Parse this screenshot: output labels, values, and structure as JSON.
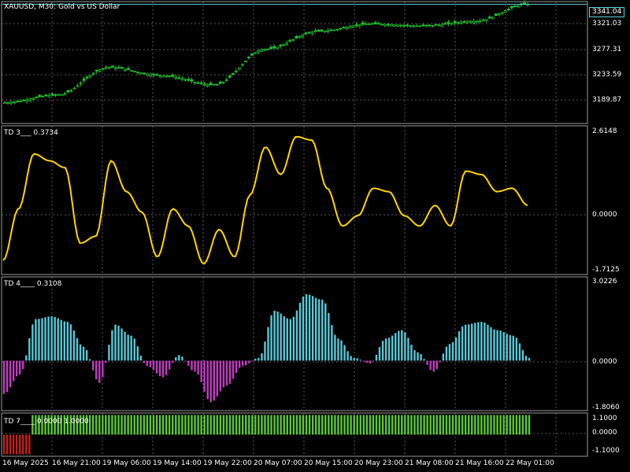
{
  "chart_window": {
    "symbol_title": "XAUUSD, M30:  Gold vs US Dollar",
    "current_price": "3341.04",
    "y_labels": [
      "3321.03",
      "3277.31",
      "3233.59",
      "3189.87"
    ],
    "colors": {
      "background": "#000000",
      "grid": "#6a6a6a",
      "price_candles": "#22c32e",
      "axis": "#ffffff"
    }
  },
  "x_axis": {
    "labels": [
      "16 May 2025",
      "16 May 21:00",
      "19 May 06:00",
      "19 May 14:00",
      "19 May 22:00",
      "20 May 07:00",
      "20 May 15:00",
      "20 May 23:00",
      "21 May 08:00",
      "21 May 16:00",
      "22 May 01:00"
    ]
  },
  "indicators": {
    "td3": {
      "title": "TD 3___ 0.3734",
      "y_labels": [
        "2.6148",
        "0.0000",
        "-1.7125"
      ],
      "color": "#ffd400"
    },
    "td4": {
      "title": "TD 4____ 0.3108",
      "y_labels": [
        "3.0226",
        "0.0000",
        "-1.8060"
      ],
      "colors": {
        "positive": "#5ac8d8",
        "negative": "#c03cc0"
      }
    },
    "td7": {
      "title": "TD 7____ 0.0000 1.0000",
      "y_labels": [
        "1.1000",
        "0.0000",
        "-1.1000"
      ],
      "colors": {
        "positive": "#5bc83a",
        "negative": "#c0201a"
      }
    }
  },
  "chart_data": [
    {
      "type": "line",
      "title": "XAUUSD, M30:  Gold vs US Dollar",
      "ylim": [
        3165,
        3345
      ],
      "x": [
        "16 May 2025",
        "16 May 21:00",
        "19 May 06:00",
        "19 May 14:00",
        "19 May 22:00",
        "20 May 07:00",
        "20 May 15:00",
        "20 May 23:00",
        "21 May 08:00",
        "21 May 16:00",
        "22 May 01:00"
      ],
      "series": [
        {
          "values": [
            3196,
            3207,
            3248,
            3236,
            3222,
            3275,
            3301,
            3312,
            3309,
            3316,
            3341
          ]
        }
      ]
    },
    {
      "type": "line",
      "title": "TD 3___ 0.3734",
      "ylim": [
        -1.7125,
        2.6148
      ],
      "series": [
        {
          "values": [
            -1.3,
            0.2,
            1.8,
            1.6,
            1.4,
            -0.8,
            -0.6,
            1.6,
            0.7,
            0.1,
            -1.2,
            0.2,
            -0.3,
            -1.4,
            -0.4,
            -1.2,
            0.6,
            2.0,
            1.2,
            2.3,
            2.2,
            0.8,
            -0.3,
            0.0,
            0.8,
            0.7,
            0.0,
            -0.3,
            0.3,
            -0.3,
            1.3,
            1.2,
            0.7,
            0.8,
            0.3
          ]
        }
      ]
    },
    {
      "type": "bar",
      "title": "TD 4____ 0.3108",
      "ylim": [
        -1.806,
        3.0226
      ],
      "series": [
        {
          "values": [
            -1.2,
            -0.5,
            1.5,
            1.6,
            1.4,
            0.5,
            -0.8,
            1.3,
            0.9,
            -0.2,
            -0.6,
            0.2,
            -0.4,
            -1.5,
            -0.9,
            -0.2,
            0.1,
            1.8,
            1.5,
            2.4,
            2.2,
            0.8,
            0.1,
            -0.1,
            0.8,
            1.1,
            0.3,
            -0.4,
            0.6,
            1.3,
            1.4,
            1.1,
            0.9,
            0.1
          ]
        }
      ]
    },
    {
      "type": "bar",
      "title": "TD 7____ 0.0000 1.0000",
      "ylim": [
        -1.1,
        1.1
      ],
      "series": [
        {
          "values": [
            -1,
            1
          ]
        }
      ]
    }
  ]
}
